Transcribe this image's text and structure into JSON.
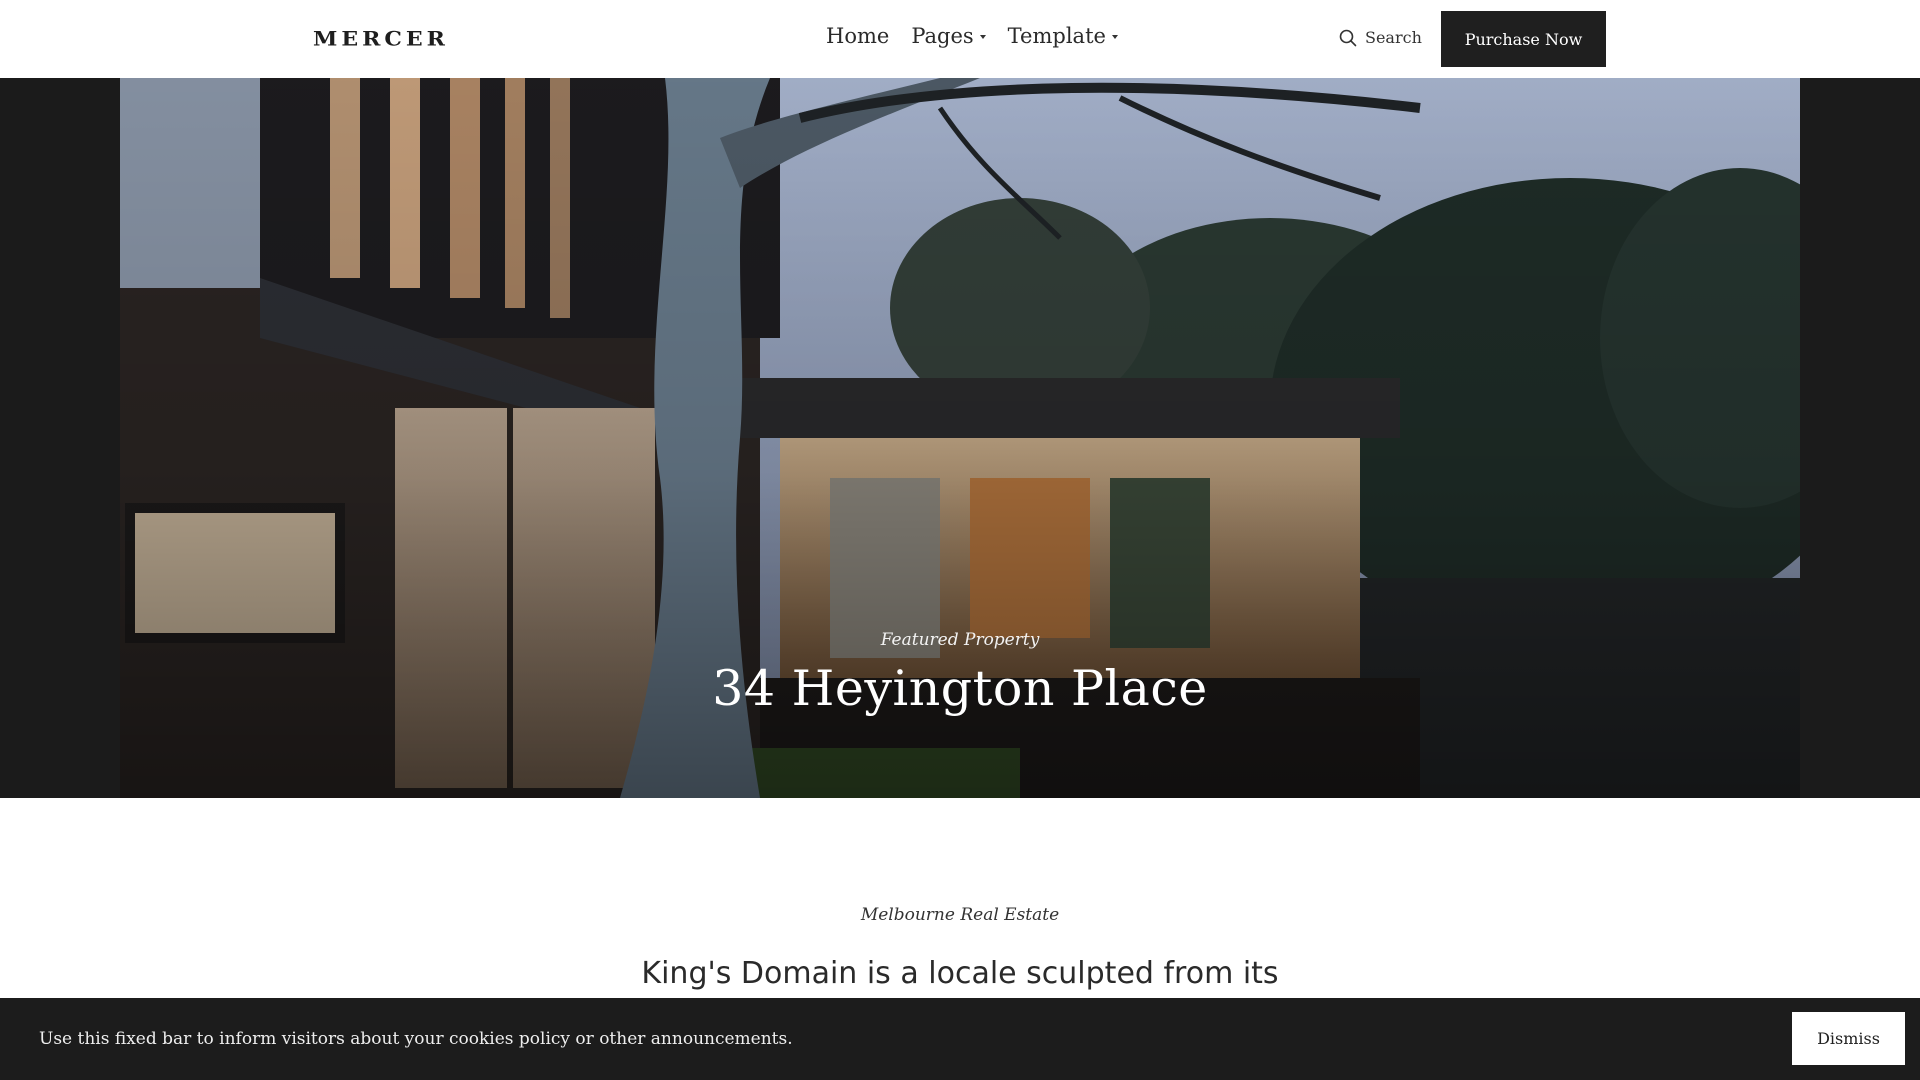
{
  "header": {
    "logo": "MERCER",
    "nav": [
      {
        "label": "Home",
        "has_dropdown": false
      },
      {
        "label": "Pages",
        "has_dropdown": true
      },
      {
        "label": "Template",
        "has_dropdown": true
      }
    ],
    "search_label": "Search",
    "purchase_label": "Purchase Now"
  },
  "hero": {
    "kicker": "Featured Property",
    "title": "34 Heyington Place"
  },
  "intro": {
    "kicker": "Melbourne Real Estate",
    "text": "King's Domain is a locale sculpted from its"
  },
  "cookie_bar": {
    "text": "Use this fixed bar to inform visitors about your cookies policy or other announcements.",
    "dismiss_label": "Dismiss"
  },
  "colors": {
    "dark": "#1f1f1f",
    "white": "#ffffff"
  }
}
